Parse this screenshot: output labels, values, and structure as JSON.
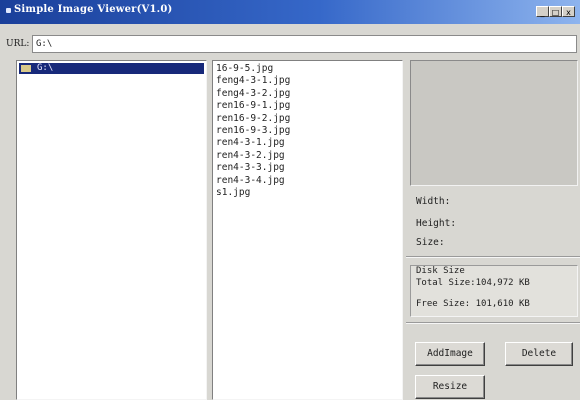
{
  "window": {
    "title": "Simple Image Viewer(V1.0)",
    "min_label": "_",
    "max_label": "□",
    "close_label": "x"
  },
  "url": {
    "label": "URL:",
    "value": "G:\\"
  },
  "tree": {
    "root_label": "G:\\"
  },
  "files": [
    "16-9-5.jpg",
    "feng4-3-1.jpg",
    "feng4-3-2.jpg",
    "ren16-9-1.jpg",
    "ren16-9-2.jpg",
    "ren16-9-3.jpg",
    "ren4-3-1.jpg",
    "ren4-3-2.jpg",
    "ren4-3-3.jpg",
    "ren4-3-4.jpg",
    "s1.jpg"
  ],
  "info": {
    "width_label": "Width:",
    "height_label": "Height:",
    "size_label": "Size:"
  },
  "disk": {
    "title": "Disk Size",
    "total_label": "Total Size:",
    "total_value": "104,972 KB",
    "free_label": "Free Size:",
    "free_value": "101,610 KB"
  },
  "buttons": {
    "add": "AddImage",
    "delete": "Delete",
    "resize": "Resize"
  }
}
